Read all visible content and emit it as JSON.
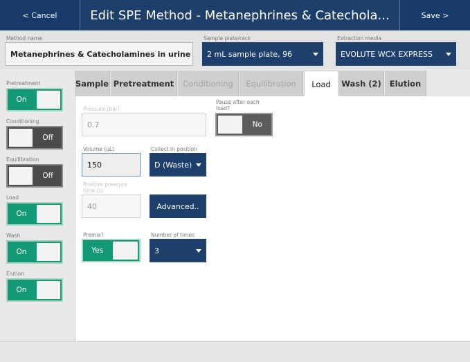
{
  "header": {
    "cancel_label": "< Cancel",
    "title": "Edit SPE Method - Metanephrines & Catechola...",
    "save_label": "Save >"
  },
  "config": {
    "method_name_label": "Method name",
    "method_name_value": "Metanephrines & Catecholamines in urine",
    "sample_plate_label": "Sample plate/rack",
    "sample_plate_value": "2 mL sample plate, 96",
    "extraction_media_label": "Extraction media",
    "extraction_media_value": "EVOLUTE WCX EXPRESS"
  },
  "sidebar": {
    "items": [
      {
        "label": "Pretreatment",
        "state": "On"
      },
      {
        "label": "Conditioning",
        "state": "Off"
      },
      {
        "label": "Equilibration",
        "state": "Off"
      },
      {
        "label": "Load",
        "state": "On"
      },
      {
        "label": "Wash",
        "state": "On"
      },
      {
        "label": "Elution",
        "state": "On"
      }
    ]
  },
  "tabs": [
    {
      "label": "Sample"
    },
    {
      "label": "Pretreatment"
    },
    {
      "label": "Conditioning"
    },
    {
      "label": "Equilibration"
    },
    {
      "label": "Load"
    },
    {
      "label": "Wash (2)"
    },
    {
      "label": "Elution"
    }
  ],
  "load": {
    "pressure_label": "Pressure (bar)",
    "pressure_value": "0.7",
    "pause_label_line1": "Pause after each",
    "pause_label_line2": "load?",
    "pause_state": "No",
    "volume_label": "Volume (µL)",
    "volume_value": "150",
    "collect_label": "Collect in position",
    "collect_value": "D (Waste)",
    "positive_pressure_label_line1": "Positive pressure",
    "positive_pressure_label_line2": "time (s)",
    "positive_pressure_value": "40",
    "advanced_label": "Advanced..",
    "premix_label": "Premix?",
    "premix_state": "Yes",
    "number_of_times_label": "Number of times",
    "number_of_times_value": "3"
  },
  "colors": {
    "header_blue": "#1e3f6b",
    "toggle_on_green": "#139a74",
    "toggle_off_gray": "#4a4a4a"
  }
}
